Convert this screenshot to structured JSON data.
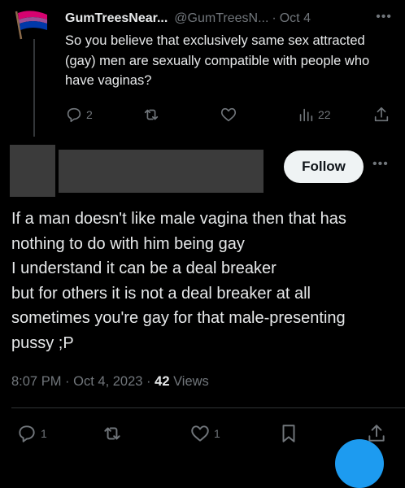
{
  "parent": {
    "display_name": "GumTreesNear...",
    "handle": "@GumTreesN...",
    "dot": "·",
    "date": "Oct 4",
    "more_icon": "more-icon",
    "text": "So you believe that exclusively same sex attracted (gay) men are sexually compatible with people who have vaginas?",
    "replies": "2",
    "views": "22",
    "avatar_icon": "flag-icon"
  },
  "main": {
    "follow_label": "Follow",
    "lines": [
      "If a man doesn't like male vagina then that has",
      "nothing to do with him being gay",
      "I understand it can be a deal breaker",
      "but for others it is not a deal breaker at all",
      "sometimes you're gay for that male-presenting",
      "pussy ;P"
    ],
    "time": "8:07 PM",
    "date": "Oct 4, 2023",
    "views_count": "42",
    "views_label": "Views",
    "replies": "1",
    "likes": "1"
  },
  "colors": {
    "background": "#000000",
    "text": "#e7e9ea",
    "muted": "#71767b",
    "redaction": "#3b3b3b",
    "accent": "#1d9bf0"
  }
}
